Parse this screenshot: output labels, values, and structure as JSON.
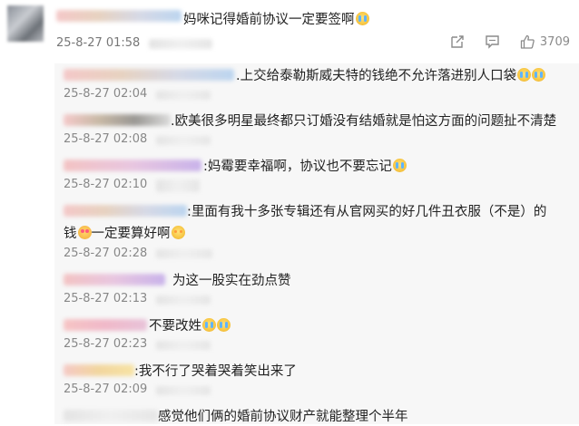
{
  "comment": {
    "text": "妈咪记得婚前协议一定要签啊",
    "time": "25-8-27 01:58",
    "likes": "3709",
    "icons": [
      "share-icon",
      "comment-icon",
      "like-icon"
    ]
  },
  "replies": [
    {
      "sep": ".",
      "text": "上交给泰勒斯威夫特的钱绝不允许落进别人口袋",
      "emoji": 2,
      "time": "25-8-27 02:04"
    },
    {
      "sep": ".",
      "text": "欧美很多明星最终都只订婚没有结婚就是怕这方面的问题扯不清楚",
      "emoji": 0,
      "time": "25-8-27 02:08"
    },
    {
      "sep": ":",
      "text": "妈霉要幸福啊，协议也不要忘记",
      "emoji": 1,
      "time": "25-8-27 02:10"
    },
    {
      "sep": ":",
      "text": "里面有我十多张专辑还有从官网买的好几件丑衣服（不是）的",
      "text2": "钱",
      "text3": "一定要算好啊",
      "time": "25-8-27 02:28"
    },
    {
      "sep": "",
      "text": "为这一股实在劲点赞",
      "emoji": 0,
      "time": "25-8-27 02:13"
    },
    {
      "sep": "",
      "text": "不要改姓",
      "emoji": 2,
      "time": "25-8-27 02:23"
    },
    {
      "sep": ":",
      "text": "我不行了哭着哭着笑出来了",
      "emoji": 0,
      "time": "25-8-27 02:09"
    },
    {
      "sep": "",
      "text": "感觉他们俩的婚前协议财产就能整理个半年",
      "emoji": 0,
      "time": ""
    }
  ]
}
